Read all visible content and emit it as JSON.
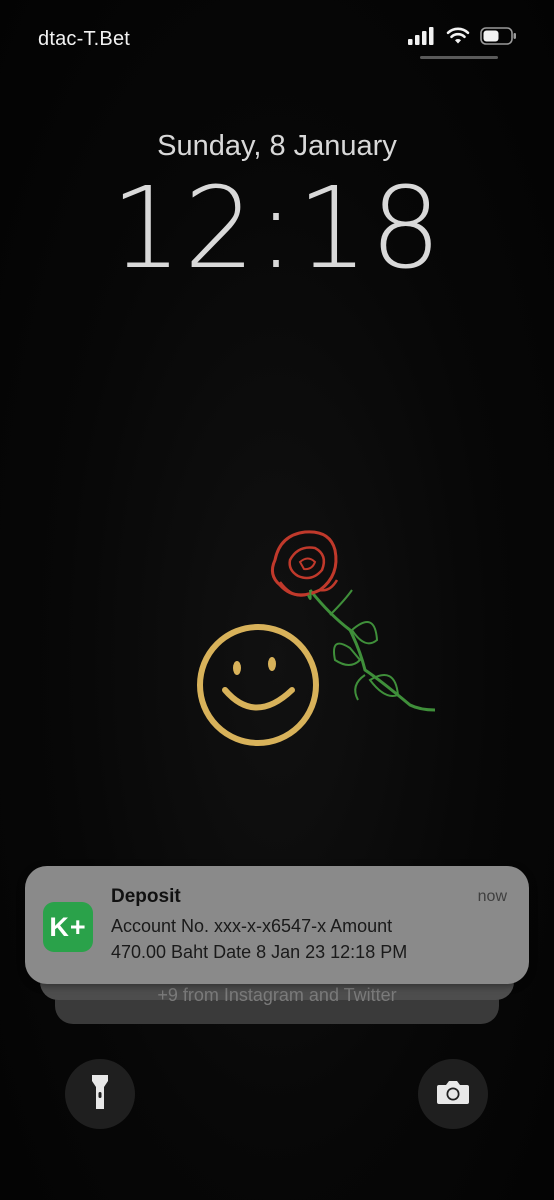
{
  "status_bar": {
    "carrier": "dtac-T.Bet",
    "icons": [
      "signal-icon",
      "wifi-icon",
      "battery-icon"
    ]
  },
  "lock_screen": {
    "date": "Sunday, 8 January",
    "time": "12:18"
  },
  "notification": {
    "app_icon_label": "K+",
    "app_icon_color": "#2aa24a",
    "title": "Deposit",
    "time": "now",
    "body": "Account No.  xxx-x-x6547-x Amount\n470.00 Baht  Date 8 Jan 23  12:18 PM",
    "stack_label": "+9 from Instagram and Twitter"
  },
  "bottom_controls": {
    "left": "flashlight-icon",
    "right": "camera-icon"
  },
  "colors": {
    "background": "#060606",
    "smiley": "#d8b25a",
    "rose": "#c0392b",
    "leaf": "#3f8f3a"
  }
}
